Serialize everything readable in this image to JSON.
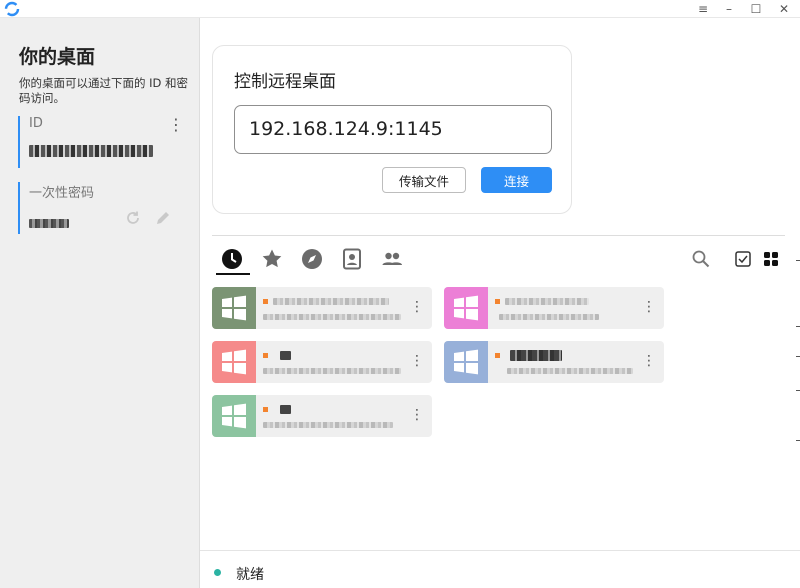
{
  "window": {
    "title_icon": "app-logo-icon",
    "controls": [
      "menu-icon",
      "minimize-icon",
      "maximize-icon",
      "close-icon"
    ]
  },
  "sidebar": {
    "title": "你的桌面",
    "description": "你的桌面可以通过下面的 ID 和密码访问。",
    "id_label": "ID",
    "password_label": "一次性密码"
  },
  "connect_card": {
    "title": "控制远程桌面",
    "remote_id_value": "192.168.124.9:1145",
    "transfer_label": "传输文件",
    "connect_label": "连接"
  },
  "tabs": [
    {
      "icon": "recent-icon",
      "active": true
    },
    {
      "icon": "star-icon",
      "active": false
    },
    {
      "icon": "discover-icon",
      "active": false
    },
    {
      "icon": "address-book-icon",
      "active": false
    },
    {
      "icon": "group-icon",
      "active": false
    }
  ],
  "view_icons": [
    "search-icon",
    "select-checkbox-icon",
    "grid-view-icon"
  ],
  "peers": [
    {
      "thumb_color": "#7b9474",
      "name": ""
    },
    {
      "thumb_color": "#ec7fd6",
      "name": ""
    },
    {
      "thumb_color": "#f58a8a",
      "name": ""
    },
    {
      "thumb_color": "#97b0d9",
      "name": ""
    },
    {
      "thumb_color": "#8cc4a0",
      "name": ""
    }
  ],
  "status": {
    "text": "就绪",
    "dot_color": "#2bb3a3"
  },
  "colors": {
    "accent": "#2e8ef5",
    "sidebar_bg": "#efefef"
  }
}
